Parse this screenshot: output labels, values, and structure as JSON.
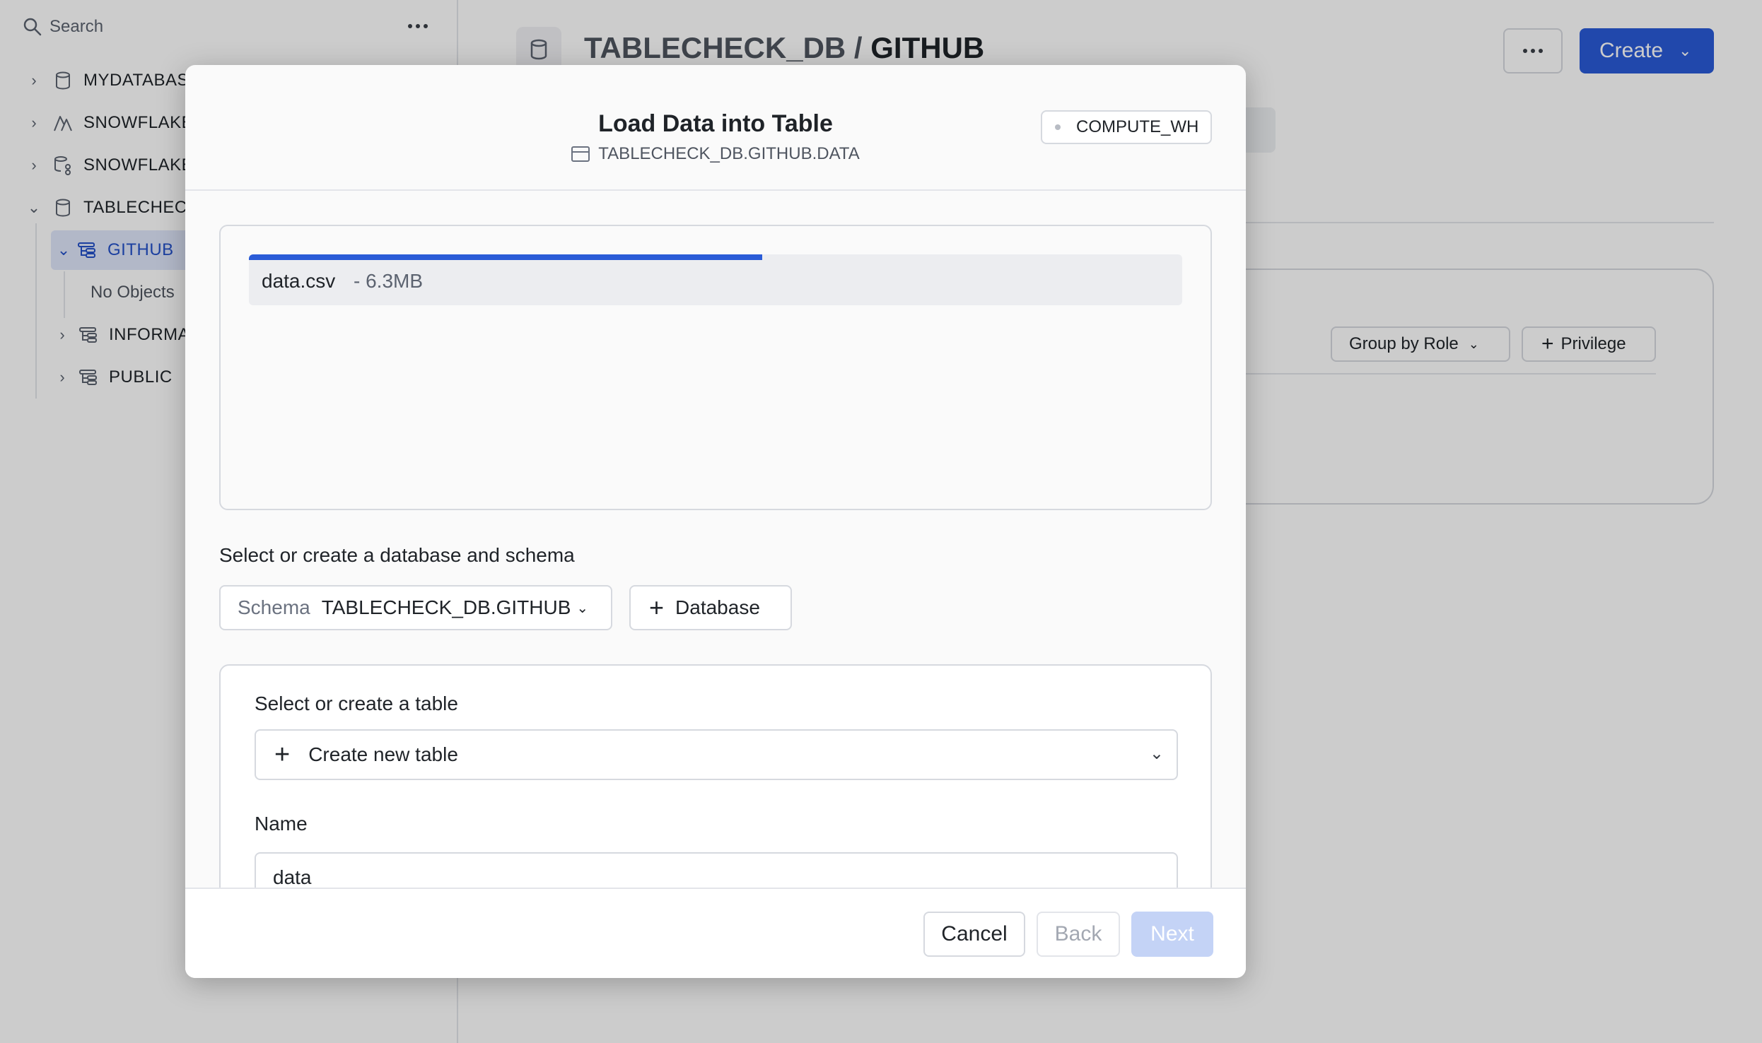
{
  "sidebar": {
    "search_label": "Search",
    "items": [
      {
        "label": "MYDATABASE"
      },
      {
        "label": "SNOWFLAKE"
      },
      {
        "label": "SNOWFLAKE"
      },
      {
        "label": "TABLECHECK_DB"
      },
      {
        "label": "GITHUB"
      },
      {
        "label": "No Objects"
      },
      {
        "label": "INFORMATION_SCHEMA"
      },
      {
        "label": "PUBLIC"
      }
    ]
  },
  "header": {
    "db_name": "TABLECHECK_DB",
    "separator": " / ",
    "schema_name": "GITHUB",
    "create_label": "Create"
  },
  "privileges": {
    "group_label": "Group by Role",
    "add_label": "Privilege"
  },
  "modal": {
    "title": "Load Data into Table",
    "target_path": "TABLECHECK_DB.GITHUB.DATA",
    "warehouse": "COMPUTE_WH",
    "file": {
      "name": "data.csv",
      "size": "- 6.3MB",
      "progress": 0.55
    },
    "schema_section_label": "Select or create a database and schema",
    "schema_select_label": "Schema",
    "schema_select_value": "TABLECHECK_DB.GITHUB",
    "database_button_label": "Database",
    "table_section_label": "Select or create a table",
    "table_select_value": "Create new table",
    "name_label": "Name",
    "name_value": "data",
    "footer": {
      "cancel": "Cancel",
      "back": "Back",
      "next": "Next"
    }
  },
  "colors": {
    "accent": "#2a5bd7",
    "accent_disabled": "#c4d3f6",
    "selected_bg": "#dfe6fb"
  }
}
